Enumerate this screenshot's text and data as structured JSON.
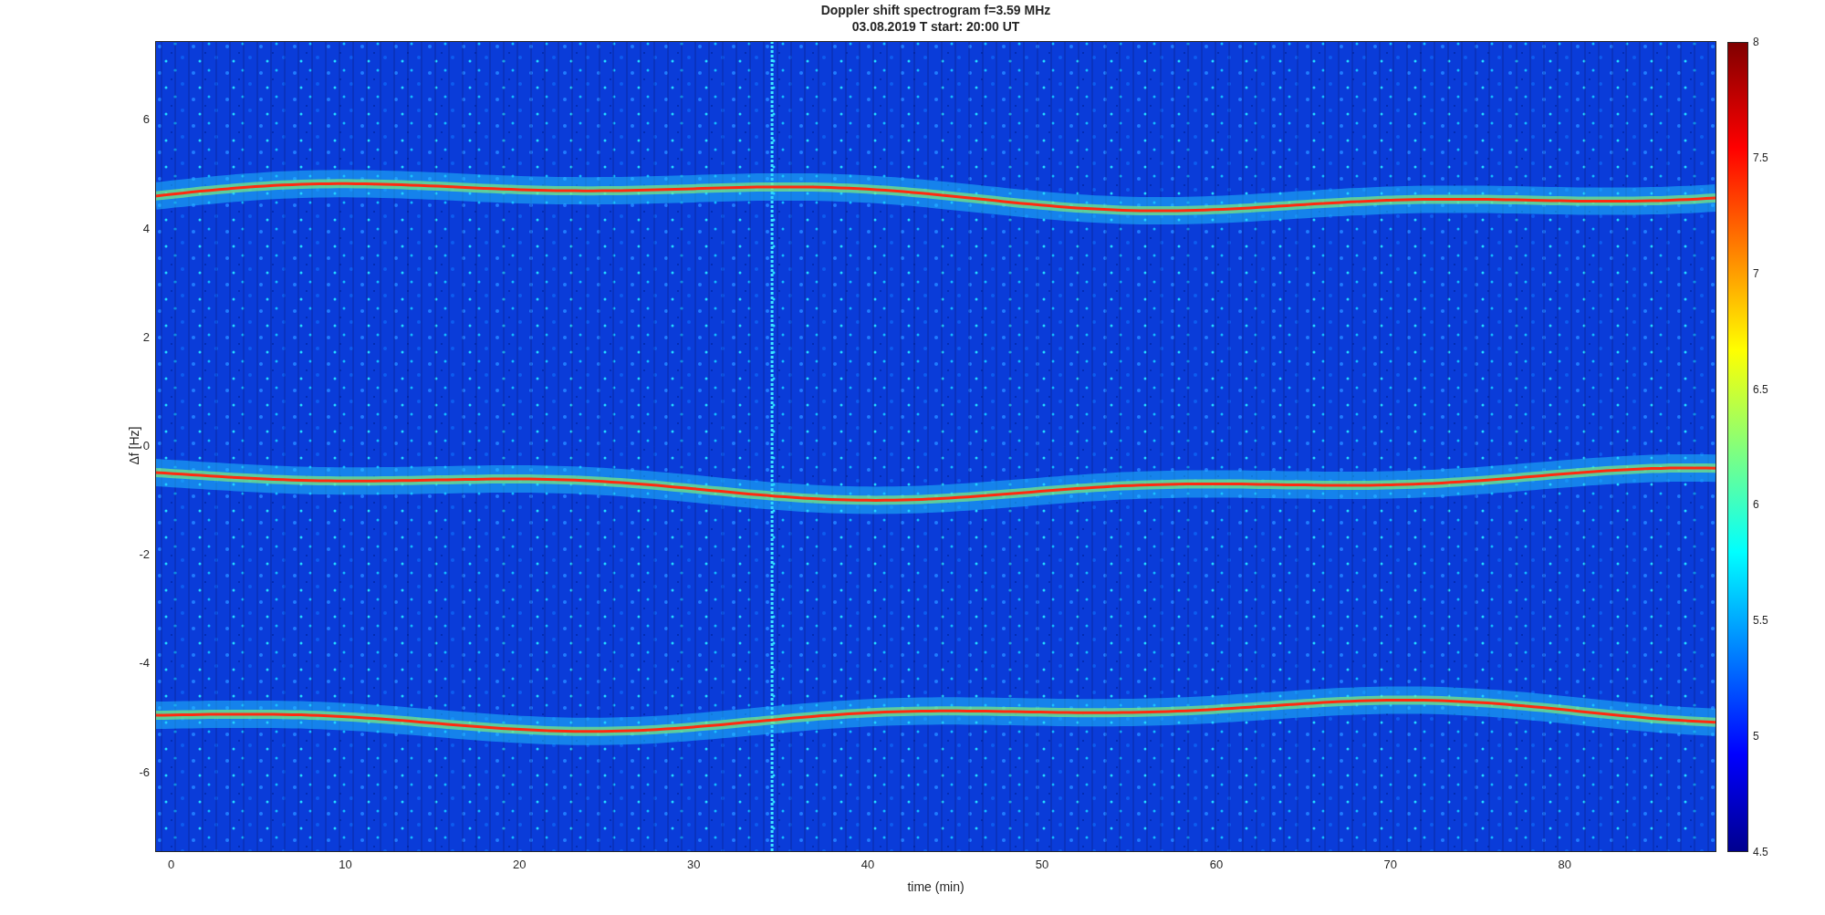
{
  "figure": {
    "title": [
      "Doppler shift spectrogram f=3.59 MHz",
      "03.08.2019   T start: 20:00 UT"
    ],
    "xlabel": "time (min)",
    "ylabel": "Δf [Hz]",
    "xticks": [
      "0",
      "10",
      "20",
      "30",
      "40",
      "50",
      "60",
      "70",
      "80"
    ],
    "yticks": [
      "6",
      "4",
      "2",
      "0",
      "-2",
      "-4",
      "-6"
    ],
    "colorbar": {
      "ticks": [
        "8",
        "7.5",
        "7",
        "6.5",
        "6",
        "5.5",
        "5",
        "4.5"
      ]
    }
  }
}
